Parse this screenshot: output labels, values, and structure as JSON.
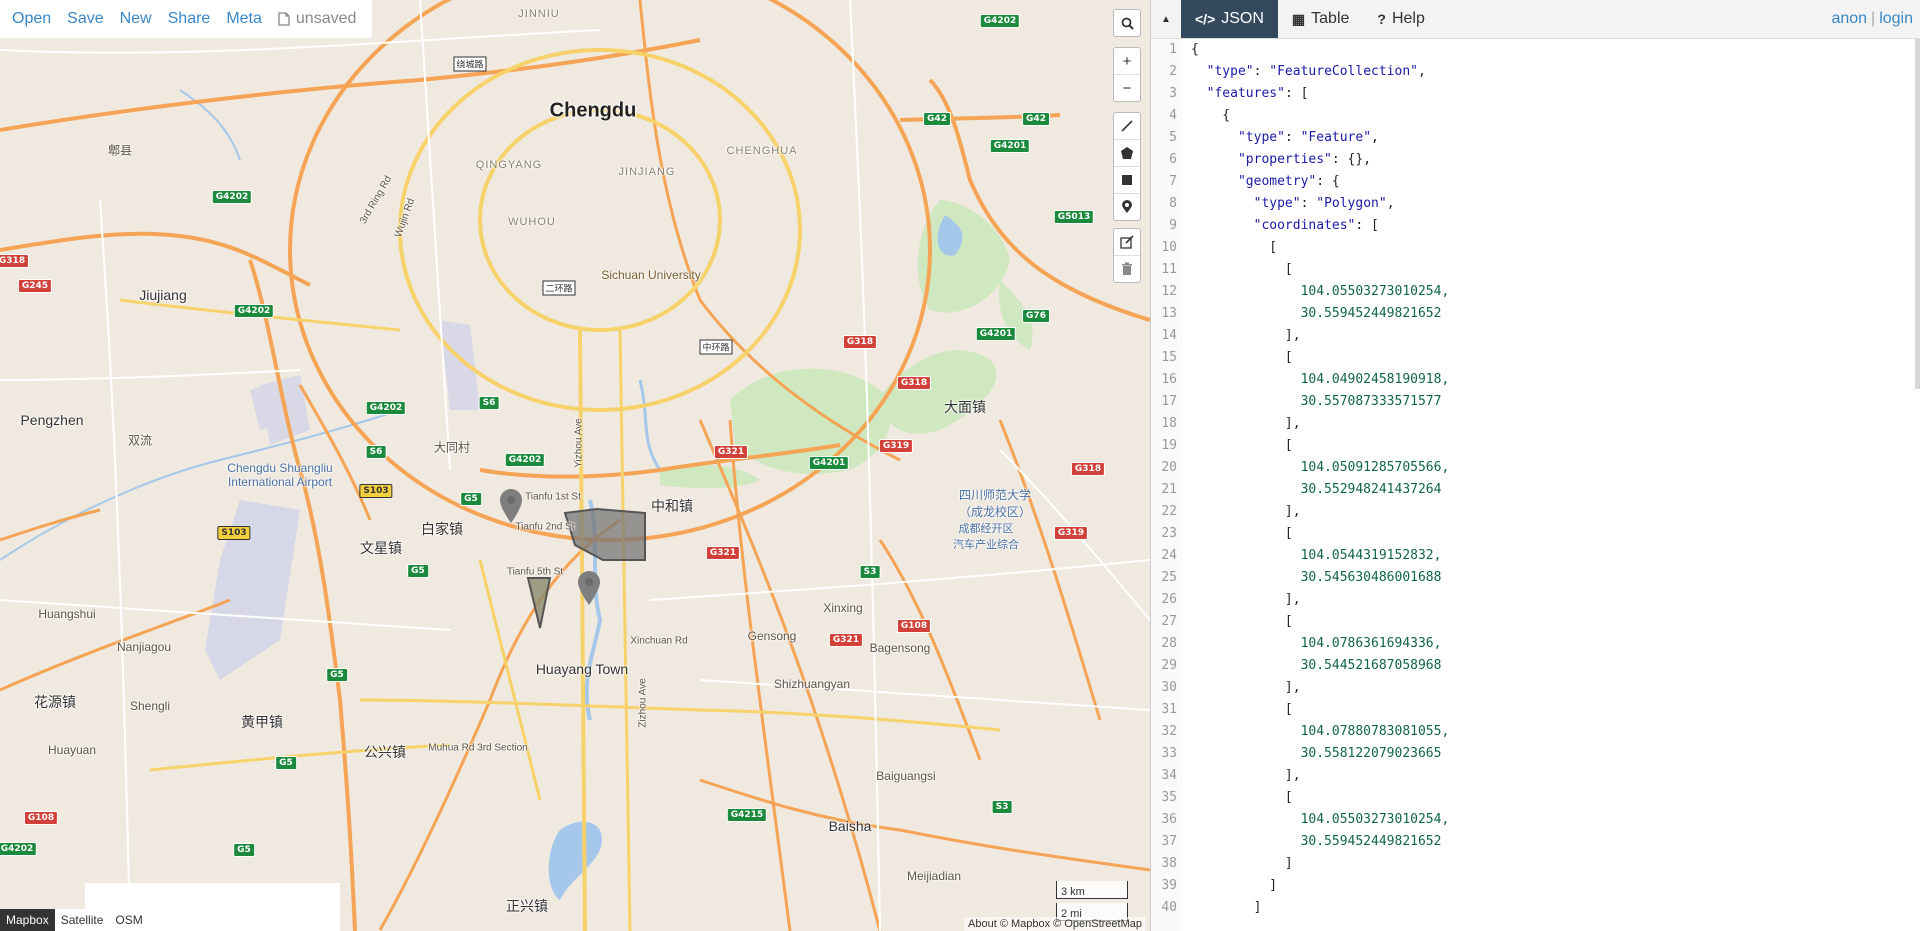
{
  "menu": {
    "open": "Open",
    "save": "Save",
    "new": "New",
    "share": "Share",
    "meta": "Meta",
    "status": "unsaved"
  },
  "map": {
    "places": [
      {
        "id": "chengdu",
        "text": "Chengdu",
        "cls": "big"
      },
      {
        "id": "jiujiang",
        "text": "Jiujiang",
        "cls": "med"
      },
      {
        "id": "pengzhen",
        "text": "Pengzhen",
        "cls": "med"
      },
      {
        "id": "huangshui",
        "text": "Huangshui",
        "cls": ""
      },
      {
        "id": "huayang",
        "text": "Huayang Town",
        "cls": "med"
      },
      {
        "id": "baisha",
        "text": "Baisha",
        "cls": "med"
      },
      {
        "id": "sichuan-univ",
        "text": "Sichuan University",
        "cls": ""
      },
      {
        "id": "airport",
        "text": "Chengdu Shuangliu\nInternational Airport",
        "cls": "blue"
      },
      {
        "id": "qingyang",
        "text": "QINGYANG",
        "cls": "dist"
      },
      {
        "id": "jinjiang",
        "text": "JINJIANG",
        "cls": "dist"
      },
      {
        "id": "wuhou",
        "text": "WUHOU",
        "cls": "dist"
      },
      {
        "id": "chenghua",
        "text": "CHENGHUA",
        "cls": "dist"
      },
      {
        "id": "jinniu",
        "text": "JINNIU",
        "cls": "dist"
      },
      {
        "id": "damian",
        "text": "大面镇",
        "cls": "med"
      },
      {
        "id": "zhonghe",
        "text": "中和镇",
        "cls": "med"
      },
      {
        "id": "baijia",
        "text": "白家镇",
        "cls": "med"
      },
      {
        "id": "wenxing",
        "text": "文星镇",
        "cls": "med"
      },
      {
        "id": "huangjia",
        "text": "黄甲镇",
        "cls": "med"
      },
      {
        "id": "gongxing",
        "text": "公兴镇",
        "cls": "med"
      },
      {
        "id": "huayuan",
        "text": "花源镇",
        "cls": "med"
      },
      {
        "id": "zhengxing",
        "text": "正兴镇",
        "cls": "med"
      },
      {
        "id": "datong",
        "text": "大同村",
        "cls": ""
      },
      {
        "id": "xinxing",
        "text": "Xinxing",
        "cls": ""
      },
      {
        "id": "gensong",
        "text": "Gensong",
        "cls": ""
      },
      {
        "id": "bagensong",
        "text": "Bagensong",
        "cls": ""
      },
      {
        "id": "shizhuangyan",
        "text": "Shizhuangyan",
        "cls": ""
      },
      {
        "id": "baiguangsi",
        "text": "Baiguangsi",
        "cls": ""
      },
      {
        "id": "meijiadian",
        "text": "Meijiadian",
        "cls": ""
      },
      {
        "id": "nanjiagou",
        "text": "Nanjiagou",
        "cls": ""
      },
      {
        "id": "shengli",
        "text": "Shengli",
        "cls": ""
      },
      {
        "id": "huayuan2",
        "text": "Huayuan",
        "cls": ""
      },
      {
        "id": "tianfu1",
        "text": "Tianfu 1st St",
        "cls": ""
      },
      {
        "id": "tianfu2",
        "text": "Tianfu 2nd St",
        "cls": ""
      },
      {
        "id": "tianfu5",
        "text": "Tianfu 5th St",
        "cls": ""
      },
      {
        "id": "xinchuan",
        "text": "Xinchuan Rd",
        "cls": ""
      },
      {
        "id": "muhua",
        "text": "Muhua Rd 3rd Section",
        "cls": ""
      },
      {
        "id": "yizhou",
        "text": "Yizhou Ave",
        "cls": ""
      },
      {
        "id": "zizhou",
        "text": "Zizhou Ave",
        "cls": ""
      },
      {
        "id": "huaiyin",
        "text": "3rd Ring Rd",
        "cls": ""
      },
      {
        "id": "wujin",
        "text": "Wujin Rd",
        "cls": ""
      },
      {
        "id": "normal-univ",
        "text": "四川师范大学\n（成龙校区）",
        "cls": "blue"
      },
      {
        "id": "jingkai",
        "text": "成都经开区\n汽车产业综合",
        "cls": "blue"
      },
      {
        "id": "pixian",
        "text": "郫县",
        "cls": ""
      },
      {
        "id": "shuangliu",
        "text": "双流",
        "cls": ""
      }
    ],
    "shields": [
      {
        "id": "g4202a",
        "text": "G4202",
        "cls": "g"
      },
      {
        "id": "g4202b",
        "text": "G4202",
        "cls": "g"
      },
      {
        "id": "g4202c",
        "text": "G4202",
        "cls": "g"
      },
      {
        "id": "g4202d",
        "text": "G4202",
        "cls": "g"
      },
      {
        "id": "g4202e",
        "text": "G4202",
        "cls": "g"
      },
      {
        "id": "g4202f",
        "text": "G4202",
        "cls": "g"
      },
      {
        "id": "g42a",
        "text": "G42",
        "cls": "g"
      },
      {
        "id": "g42b",
        "text": "G42",
        "cls": "g"
      },
      {
        "id": "g4201a",
        "text": "G4201",
        "cls": "g"
      },
      {
        "id": "g4201b",
        "text": "G4201",
        "cls": "g"
      },
      {
        "id": "g4201c",
        "text": "G4201",
        "cls": "g"
      },
      {
        "id": "g5013",
        "text": "G5013",
        "cls": "g"
      },
      {
        "id": "g76",
        "text": "G76",
        "cls": "g"
      },
      {
        "id": "s6",
        "text": "S6",
        "cls": "g"
      },
      {
        "id": "s6b",
        "text": "S6",
        "cls": "g"
      },
      {
        "id": "g5a",
        "text": "G5",
        "cls": "g"
      },
      {
        "id": "g5b",
        "text": "G5",
        "cls": "g"
      },
      {
        "id": "g5c",
        "text": "G5",
        "cls": "g"
      },
      {
        "id": "g5d",
        "text": "G5",
        "cls": "g"
      },
      {
        "id": "g5e",
        "text": "G5",
        "cls": "g"
      },
      {
        "id": "s3a",
        "text": "S3",
        "cls": "g"
      },
      {
        "id": "s3b",
        "text": "S3",
        "cls": "g"
      },
      {
        "id": "g4215",
        "text": "G4215",
        "cls": "g"
      },
      {
        "id": "g318a",
        "text": "G318",
        "cls": "r"
      },
      {
        "id": "g318b",
        "text": "G318",
        "cls": "r"
      },
      {
        "id": "g318c",
        "text": "G318",
        "cls": "r"
      },
      {
        "id": "g318d",
        "text": "G318",
        "cls": "r"
      },
      {
        "id": "g319a",
        "text": "G319",
        "cls": "r"
      },
      {
        "id": "g319b",
        "text": "G319",
        "cls": "r"
      },
      {
        "id": "g321a",
        "text": "G321",
        "cls": "r"
      },
      {
        "id": "g321b",
        "text": "G321",
        "cls": "r"
      },
      {
        "id": "g321c",
        "text": "G321",
        "cls": "r"
      },
      {
        "id": "g108a",
        "text": "G108",
        "cls": "r"
      },
      {
        "id": "g108b",
        "text": "G108",
        "cls": "r"
      },
      {
        "id": "g245",
        "text": "G245",
        "cls": "r"
      },
      {
        "id": "s103a",
        "text": "S103",
        "cls": "y"
      },
      {
        "id": "s103b",
        "text": "S103",
        "cls": "y"
      }
    ],
    "rings": [
      {
        "id": "r1",
        "text": "二环路"
      },
      {
        "id": "r2",
        "text": "中环路"
      },
      {
        "id": "r3",
        "text": "绕城路"
      }
    ],
    "layers": [
      "Mapbox",
      "Satellite",
      "OSM"
    ],
    "active_layer": "Mapbox",
    "scale_km": "3 km",
    "scale_mi": "2 mi",
    "attribution": "About © Mapbox © OpenStreetMap"
  },
  "panel": {
    "tabs": [
      {
        "id": "json",
        "icon": "</>",
        "label": "JSON",
        "active": true
      },
      {
        "id": "table",
        "icon": "▦",
        "label": "Table",
        "active": false
      },
      {
        "id": "help",
        "icon": "?",
        "label": "Help",
        "active": false
      }
    ],
    "user_anon": "anon",
    "user_sep": "|",
    "user_login": "login"
  },
  "json_lines": [
    "{",
    "  \"type\": \"FeatureCollection\",",
    "  \"features\": [",
    "    {",
    "      \"type\": \"Feature\",",
    "      \"properties\": {},",
    "      \"geometry\": {",
    "        \"type\": \"Polygon\",",
    "        \"coordinates\": [",
    "          [",
    "            [",
    "              104.05503273010254,",
    "              30.559452449821652",
    "            ],",
    "            [",
    "              104.04902458190918,",
    "              30.557087333571577",
    "            ],",
    "            [",
    "              104.05091285705566,",
    "              30.552948241437264",
    "            ],",
    "            [",
    "              104.0544319152832,",
    "              30.545630486001688",
    "            ],",
    "            [",
    "              104.0786361694336,",
    "              30.544521687058968",
    "            ],",
    "            [",
    "              104.07880783081055,",
    "              30.558122079023665",
    "            ],",
    "            [",
    "              104.05503273010254,",
    "              30.559452449821652",
    "            ]",
    "          ]",
    "        ]"
  ]
}
